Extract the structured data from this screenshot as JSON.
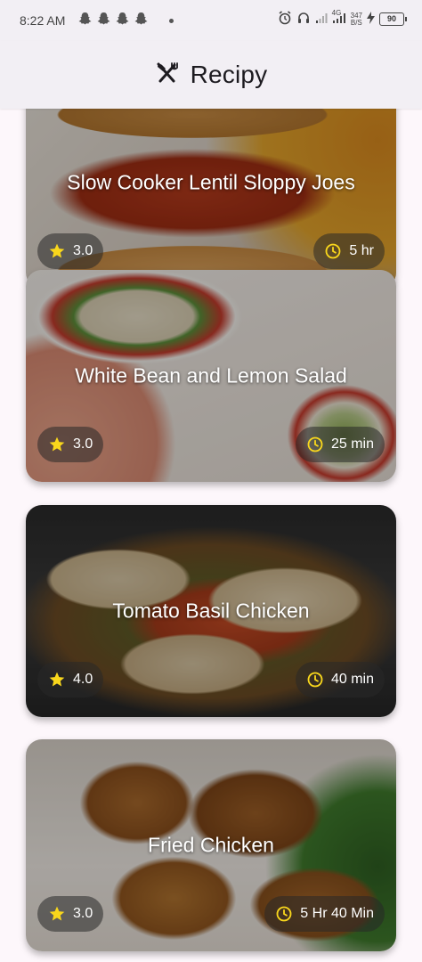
{
  "status_bar": {
    "time": "8:22 AM",
    "network_badge": "4G",
    "speed_value": "347",
    "speed_unit": "B/S",
    "battery": "90"
  },
  "app_bar": {
    "title": "Recipy",
    "icon": "fork-knife-icon"
  },
  "recipes": [
    {
      "name": "Slow Cooker Lentil Sloppy Joes",
      "rating": "3.0",
      "time": "5 hr"
    },
    {
      "name": "White Bean and Lemon Salad",
      "rating": "3.0",
      "time": "25 min"
    },
    {
      "name": "Tomato Basil Chicken",
      "rating": "4.0",
      "time": "40 min"
    },
    {
      "name": "Fried Chicken",
      "rating": "3.0",
      "time": "5 Hr 40 Min"
    }
  ],
  "colors": {
    "star": "#f9d71c",
    "clock": "#f9d71c",
    "app_bar_bg": "#f2eff4"
  }
}
